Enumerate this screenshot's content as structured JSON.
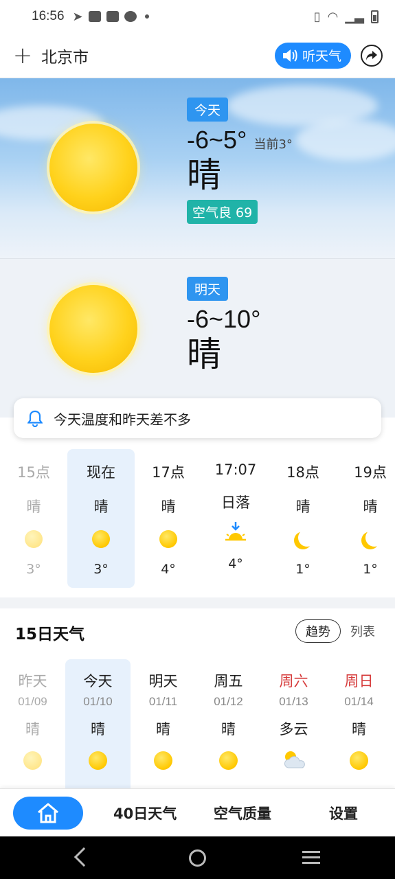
{
  "status_bar": {
    "time": "16:56"
  },
  "header": {
    "add_label": "+",
    "city": "北京市",
    "listen_label": "听天气"
  },
  "today": {
    "tag": "今天",
    "temp_range": "-6~5°",
    "current": "当前3°",
    "condition": "晴",
    "aqi": "空气良 69"
  },
  "tomorrow": {
    "tag": "明天",
    "temp_range": "-6~10°",
    "condition": "晴"
  },
  "notice": {
    "text": "今天温度和昨天差不多"
  },
  "hourly": [
    {
      "time": "15点",
      "cond": "晴",
      "icon": "sun-icon",
      "temp": "3°",
      "state": "past"
    },
    {
      "time": "现在",
      "cond": "晴",
      "icon": "sun-icon",
      "temp": "3°",
      "state": "active"
    },
    {
      "time": "17点",
      "cond": "晴",
      "icon": "sun-icon",
      "temp": "4°",
      "state": ""
    },
    {
      "time": "17:07",
      "cond": "日落",
      "icon": "sunset-icon",
      "temp": "4°",
      "state": ""
    },
    {
      "time": "18点",
      "cond": "晴",
      "icon": "moon-icon",
      "temp": "1°",
      "state": ""
    },
    {
      "time": "19点",
      "cond": "晴",
      "icon": "moon-icon",
      "temp": "1°",
      "state": ""
    }
  ],
  "forecast": {
    "title": "15日天气",
    "trend_label": "趋势",
    "list_label": "列表",
    "days": [
      {
        "name": "昨天",
        "date": "01/09",
        "cond": "晴",
        "icon": "sun-icon",
        "state": "past"
      },
      {
        "name": "今天",
        "date": "01/10",
        "cond": "晴",
        "icon": "sun-icon",
        "state": "active"
      },
      {
        "name": "明天",
        "date": "01/11",
        "cond": "晴",
        "icon": "sun-icon",
        "state": ""
      },
      {
        "name": "周五",
        "date": "01/12",
        "cond": "晴",
        "icon": "sun-icon",
        "state": ""
      },
      {
        "name": "周六",
        "date": "01/13",
        "cond": "多云",
        "icon": "cloudy-icon",
        "state": "weekend"
      },
      {
        "name": "周日",
        "date": "01/14",
        "cond": "晴",
        "icon": "sun-icon",
        "state": "weekend"
      }
    ]
  },
  "bottom_nav": {
    "forty_day": "40日天气",
    "air_quality": "空气质量",
    "settings": "设置"
  },
  "colors": {
    "accent": "#1e8bff",
    "aqi": "#20b3a8",
    "weekend": "#d63b3b",
    "sun": "#ffc800"
  }
}
